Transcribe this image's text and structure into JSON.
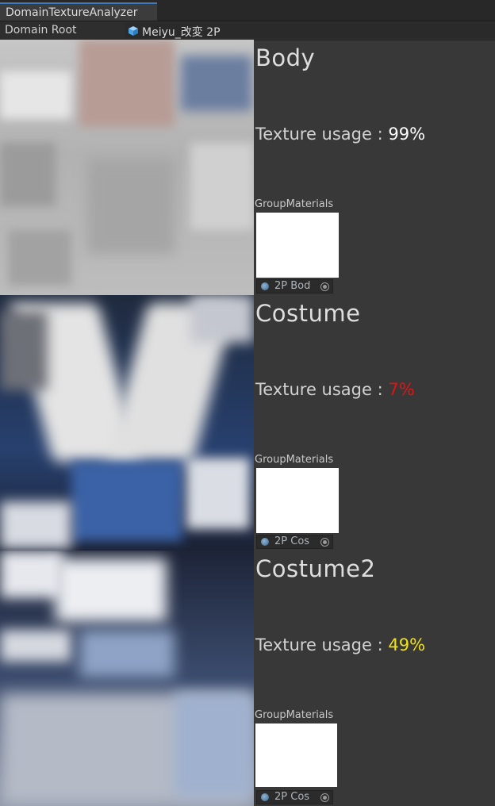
{
  "window": {
    "tab_title": "DomainTextureAnalyzer"
  },
  "domain_root": {
    "label": "Domain Root",
    "object_name": "Meiyu_改変 2P",
    "icon": "gameobject-cube-icon"
  },
  "sections": [
    {
      "title": "Body",
      "usage_label": "Texture usage :",
      "usage_value": "99%",
      "usage_color": "#ffffff",
      "group_label": "GroupMaterials",
      "material_name": "2P Bod"
    },
    {
      "title": "Costume",
      "usage_label": "Texture usage :",
      "usage_value": "7%",
      "usage_color": "#e01414",
      "group_label": "GroupMaterials",
      "material_name": "2P Cos"
    },
    {
      "title": "Costume2",
      "usage_label": "Texture usage :",
      "usage_value": "49%",
      "usage_color": "#f0e018",
      "group_label": "GroupMaterials",
      "material_name": "2P Cos"
    }
  ]
}
